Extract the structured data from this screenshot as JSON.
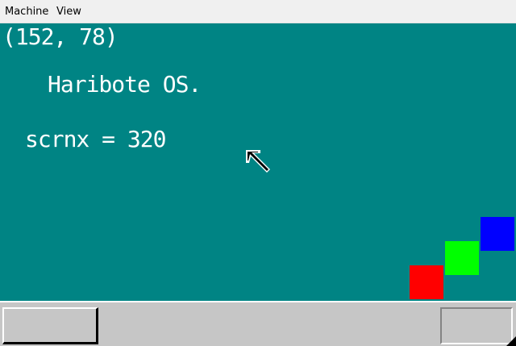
{
  "window": {
    "menu": [
      {
        "label": "Machine"
      },
      {
        "label": "View"
      }
    ]
  },
  "screen": {
    "mouse_coords": "(152, 78)",
    "os_title": "Haribote OS.",
    "scrnx_text": "scrnx = 320",
    "colors": {
      "background": "#008484",
      "text": "#ffffff",
      "box_red": "#ff0000",
      "box_green": "#00ff00",
      "box_blue": "#0000ff",
      "taskbar": "#c6c6c6"
    }
  },
  "icons": [
    "mouse-pointer-icon",
    "resize-grip-icon"
  ]
}
